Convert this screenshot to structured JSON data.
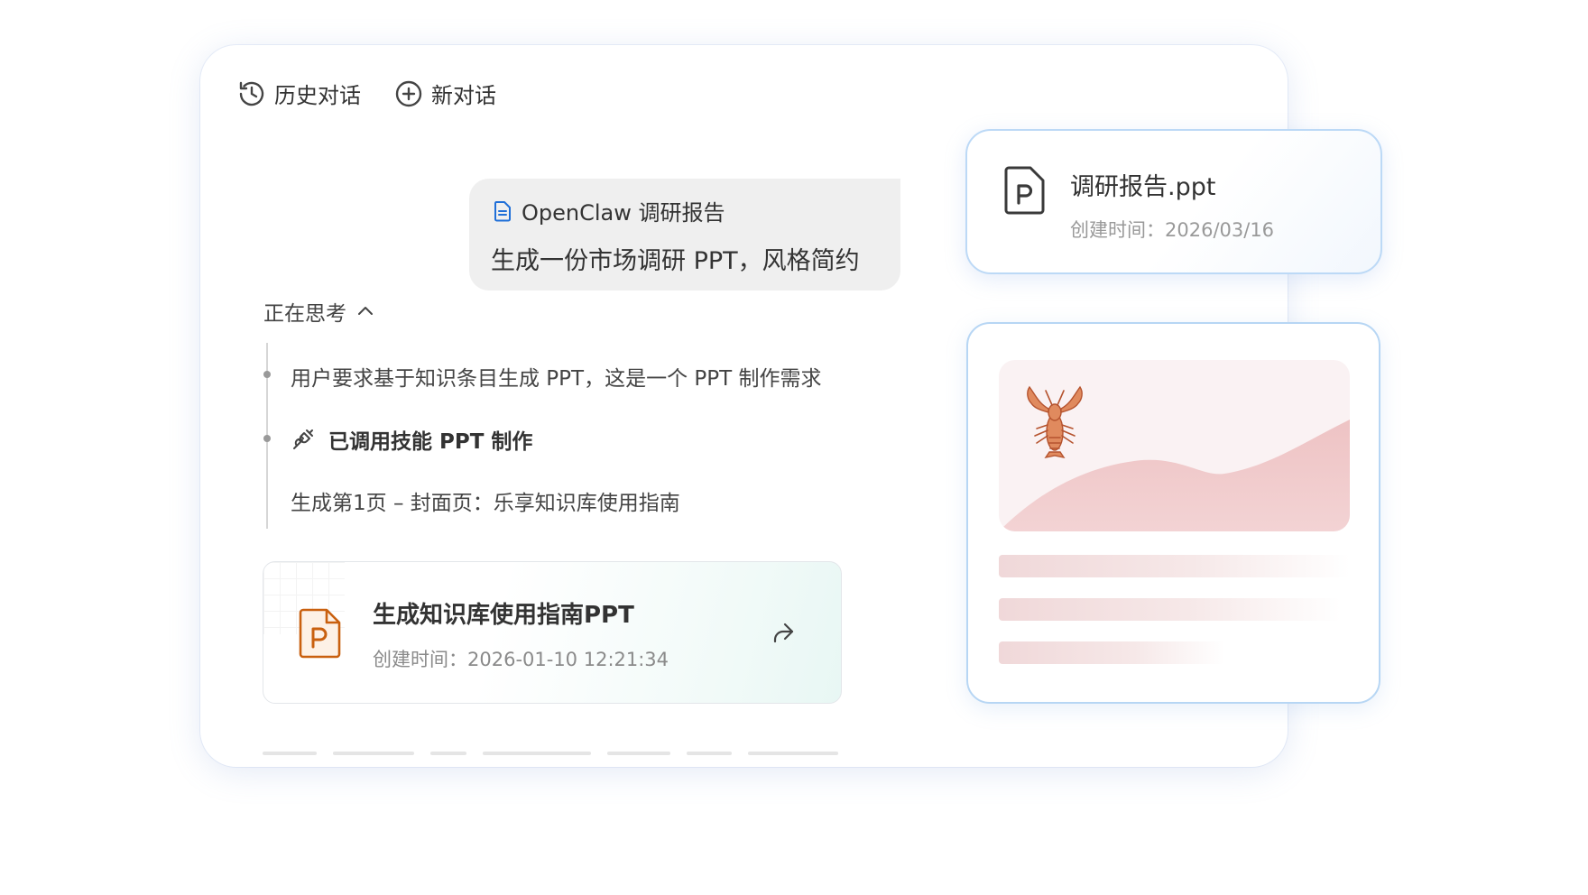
{
  "toolbar": {
    "history_label": "历史对话",
    "new_chat_label": "新对话"
  },
  "user_message": {
    "attachment_name": "OpenClaw 调研报告",
    "text": "生成一份市场调研 PPT，风格简约"
  },
  "thinking": {
    "label": "正在思考",
    "steps": [
      "用户要求基于知识条目生成 PPT，这是一个 PPT 制作需求",
      "已调用技能 PPT 制作",
      "生成第1页 – 封面页：乐享知识库使用指南"
    ]
  },
  "result_file": {
    "title": "生成知识库使用指南PPT",
    "created": "创建时间：2026-01-10 12:21:34",
    "icon": "ppt-file-icon",
    "accent": "#c9600f"
  },
  "doc_card": {
    "name": "调研报告.ppt",
    "created": "创建时间：2026/03/16",
    "icon": "ppt-file-icon"
  },
  "preview": {
    "emoji": "lobster",
    "accent": "#e8b6b8"
  },
  "colors": {
    "card_border": "#bcd9f6",
    "bubble_bg": "#efefef",
    "doc_icon_blue": "#1f6fd8"
  }
}
